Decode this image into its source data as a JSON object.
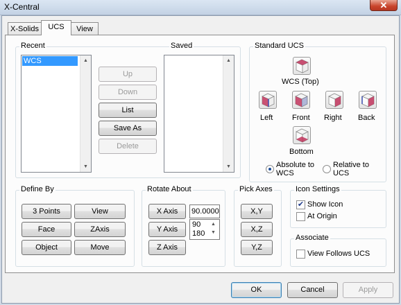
{
  "window": {
    "title": "X-Central",
    "close_glyph": "✕"
  },
  "tabs": [
    {
      "label": "X-Solids"
    },
    {
      "label": "UCS"
    },
    {
      "label": "View"
    }
  ],
  "recent": {
    "label": "Recent",
    "items": [
      "WCS"
    ]
  },
  "saved": {
    "label": "Saved",
    "items": []
  },
  "list_buttons": {
    "up": "Up",
    "down": "Down",
    "list": "List",
    "save_as": "Save As",
    "delete": "Delete"
  },
  "standard_ucs": {
    "label": "Standard UCS",
    "top": "WCS (Top)",
    "left": "Left",
    "front": "Front",
    "right": "Right",
    "back": "Back",
    "bottom": "Bottom",
    "absolute": "Absolute to WCS",
    "relative": "Relative to UCS",
    "selected": "absolute"
  },
  "define_by": {
    "label": "Define By",
    "three_points": "3 Points",
    "view": "View",
    "face": "Face",
    "zaxis": "ZAxis",
    "object": "Object",
    "move": "Move"
  },
  "rotate_about": {
    "label": "Rotate About",
    "x_axis": "X Axis",
    "y_axis": "Y Axis",
    "z_axis": "Z Axis",
    "angle_value": "90.0000",
    "angle_options": [
      "90",
      "180"
    ]
  },
  "pick_axes": {
    "label": "Pick Axes",
    "xy": "X,Y",
    "xz": "X,Z",
    "yz": "Y,Z"
  },
  "icon_settings": {
    "label": "Icon Settings",
    "show_icon": "Show Icon",
    "show_icon_checked": true,
    "at_origin": "At Origin",
    "at_origin_checked": false
  },
  "associate": {
    "label": "Associate",
    "view_follows": "View Follows UCS",
    "view_follows_checked": false
  },
  "footer": {
    "ok": "OK",
    "cancel": "Cancel",
    "apply": "Apply"
  },
  "colors": {
    "selection": "#3399ff",
    "accent": "#3c7fb1",
    "cube_face_red": "#c0335a",
    "cube_face_blue": "#3b4fb0"
  }
}
